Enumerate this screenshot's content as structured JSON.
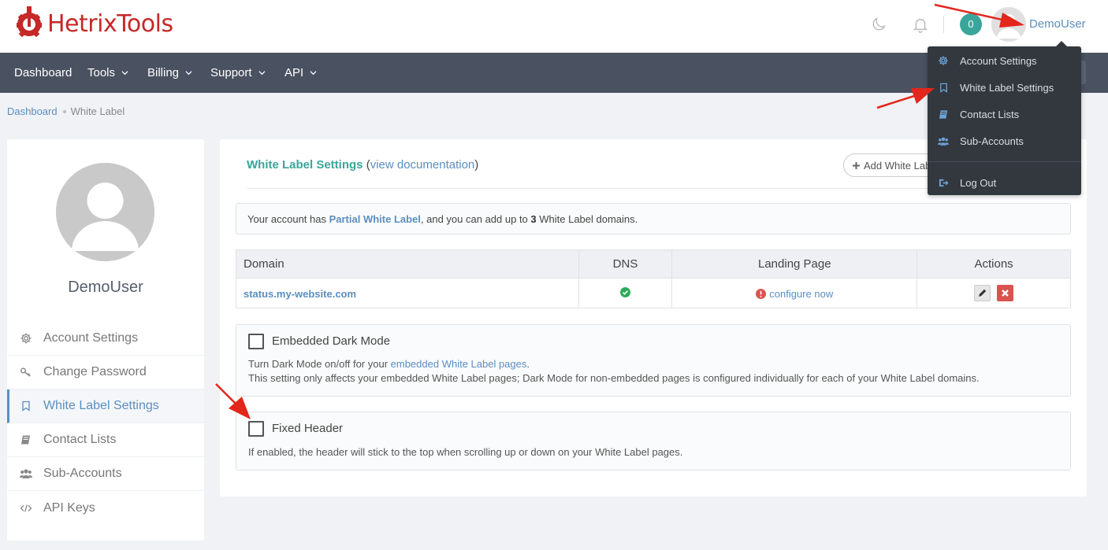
{
  "brand": {
    "name": "HetrixTools"
  },
  "header": {
    "notification_count": "0",
    "username": "DemoUser"
  },
  "nav": [
    {
      "label": "Dashboard",
      "has_menu": false
    },
    {
      "label": "Tools",
      "has_menu": true
    },
    {
      "label": "Billing",
      "has_menu": true
    },
    {
      "label": "Support",
      "has_menu": true
    },
    {
      "label": "API",
      "has_menu": true
    }
  ],
  "breadcrumb": {
    "root": "Dashboard",
    "current": "White Label"
  },
  "sidebar": {
    "username": "DemoUser",
    "items": [
      {
        "label": "Account Settings",
        "icon": "gear-icon"
      },
      {
        "label": "Change Password",
        "icon": "key-icon"
      },
      {
        "label": "White Label Settings",
        "icon": "bookmark-icon",
        "active": true
      },
      {
        "label": "Contact Lists",
        "icon": "book-icon"
      },
      {
        "label": "Sub-Accounts",
        "icon": "users-icon"
      },
      {
        "label": "API Keys",
        "icon": "code-icon"
      }
    ]
  },
  "main": {
    "title": "White Label Settings",
    "doc_open": "(",
    "doc_link": "view documentation",
    "doc_close": ")",
    "add_button": "Add White Label",
    "info": {
      "prefix": "Your account has ",
      "plan": "Partial White Label",
      "middle": ", and you can add up to ",
      "count": "3",
      "suffix": " White Label domains."
    },
    "table": {
      "headers": [
        "Domain",
        "DNS",
        "Landing Page",
        "Actions"
      ],
      "rows": [
        {
          "domain": "status.my-website.com",
          "dns_ok": true,
          "landing": "configure now"
        }
      ]
    },
    "options": [
      {
        "label": "Embedded Dark Mode",
        "checked": false,
        "desc_prefix": "Turn Dark Mode on/off for your ",
        "desc_link": "embedded White Label pages",
        "desc_suffix": ".",
        "desc_line2": "This setting only affects your embedded White Label pages; Dark Mode for non-embedded pages is configured individually for each of your White Label domains."
      },
      {
        "label": "Fixed Header",
        "checked": false,
        "desc": "If enabled, the header will stick to the top when scrolling up or down on your White Label pages."
      }
    ]
  },
  "dropdown": {
    "items": [
      {
        "label": "Account Settings",
        "icon": "gear-icon"
      },
      {
        "label": "White Label Settings",
        "icon": "bookmark-icon"
      },
      {
        "label": "Contact Lists",
        "icon": "book-icon"
      },
      {
        "label": "Sub-Accounts",
        "icon": "users-icon"
      }
    ],
    "logout": {
      "label": "Log Out",
      "icon": "logout-icon"
    }
  },
  "colors": {
    "brand": "#c62828",
    "accent": "#3aa59a",
    "link": "#5b8ec0",
    "nav_bg": "#4a5160",
    "annotation_arrow": "#e3261b"
  }
}
